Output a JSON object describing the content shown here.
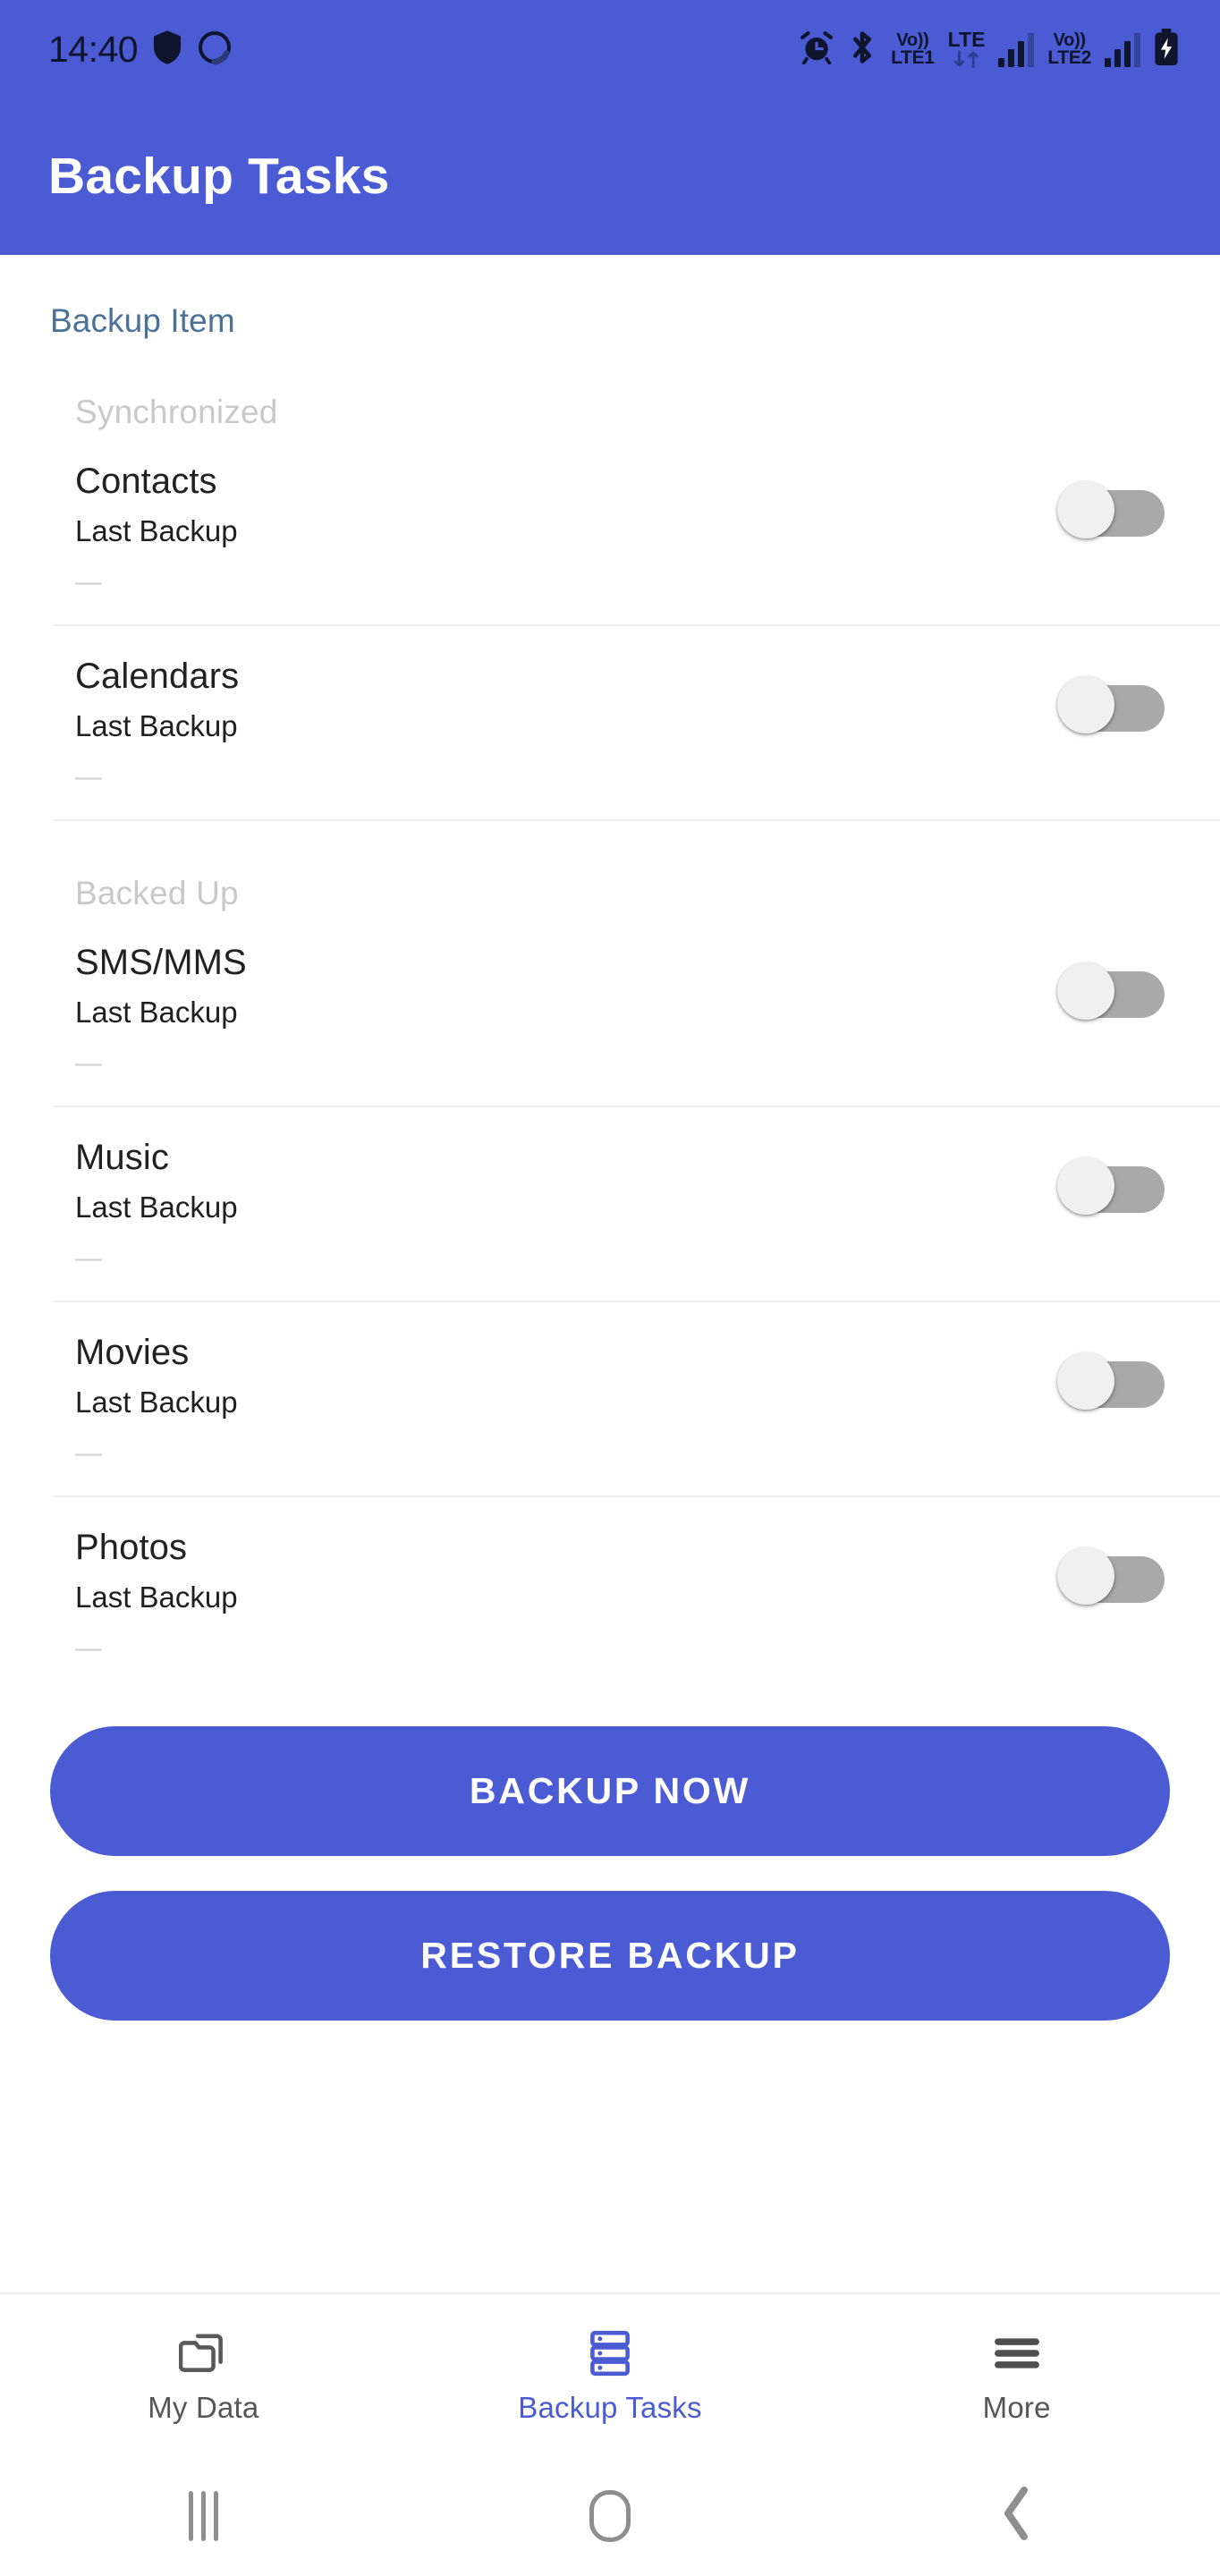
{
  "status_bar": {
    "time": "14:40",
    "left_icons": [
      "shield-icon",
      "circle-loading-icon"
    ],
    "right_icons": [
      "alarm-icon",
      "bluetooth-icon",
      "volte1-icon",
      "lte-data-icon",
      "signal-bars-sim1-icon",
      "volte2-icon",
      "signal-bars-sim2-icon",
      "battery-charging-icon"
    ],
    "volte1_top": "Vo))",
    "volte1_bottom": "LTE1",
    "lte_label": "LTE",
    "volte2_top": "Vo))",
    "volte2_bottom": "LTE2"
  },
  "app_bar": {
    "title": "Backup Tasks"
  },
  "content": {
    "section_title": "Backup Item",
    "groups": [
      {
        "label": "Synchronized",
        "items": [
          {
            "title": "Contacts",
            "subtitle": "Last Backup",
            "value": "—",
            "toggle_on": false
          },
          {
            "title": "Calendars",
            "subtitle": "Last Backup",
            "value": "—",
            "toggle_on": false
          }
        ]
      },
      {
        "label": "Backed Up",
        "items": [
          {
            "title": "SMS/MMS",
            "subtitle": "Last Backup",
            "value": "—",
            "toggle_on": false
          },
          {
            "title": "Music",
            "subtitle": "Last Backup",
            "value": "—",
            "toggle_on": false
          },
          {
            "title": "Movies",
            "subtitle": "Last Backup",
            "value": "—",
            "toggle_on": false
          },
          {
            "title": "Photos",
            "subtitle": "Last Backup",
            "value": "—",
            "toggle_on": false
          }
        ]
      }
    ]
  },
  "actions": {
    "backup_now": "BACKUP NOW",
    "restore_backup": "RESTORE BACKUP"
  },
  "bottom_nav": {
    "items": [
      {
        "label": "My Data",
        "icon": "folders-icon",
        "active": false
      },
      {
        "label": "Backup Tasks",
        "icon": "server-stack-icon",
        "active": true
      },
      {
        "label": "More",
        "icon": "hamburger-icon",
        "active": false
      }
    ]
  },
  "system_nav": {
    "recents": "recents-button",
    "home": "home-button",
    "back": "back-button"
  },
  "colors": {
    "primary": "#4b5bd4",
    "section_title": "#4a7298",
    "group_label": "#c9c9c9",
    "row_title": "#212121",
    "nav_inactive": "#555555",
    "toggle_track_off": "#a9a9a9",
    "toggle_thumb_off": "#f0f0f0"
  }
}
